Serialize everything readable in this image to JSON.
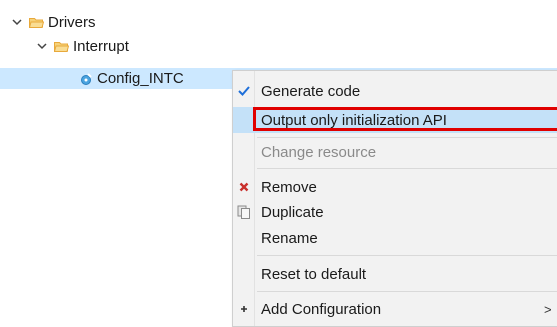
{
  "tree": {
    "drivers": {
      "label": "Drivers"
    },
    "interrupt": {
      "label": "Interrupt"
    },
    "config": {
      "label": "Config_INTC"
    }
  },
  "menu": {
    "items": [
      {
        "label": "Generate code",
        "icon": "checkmark-icon",
        "checked": true,
        "disabled": false
      },
      {
        "label": "Output only initialization API",
        "highlighted": true,
        "disabled": false
      },
      {
        "label": "Change resource",
        "disabled": true
      },
      {
        "label": "Remove",
        "icon": "remove-icon",
        "disabled": false
      },
      {
        "label": "Duplicate",
        "icon": "duplicate-icon",
        "disabled": false
      },
      {
        "label": "Rename",
        "disabled": false
      },
      {
        "label": "Reset to default",
        "disabled": false
      },
      {
        "label": "Add Configuration",
        "icon": "add-icon",
        "submenu": true,
        "disabled": false
      }
    ],
    "submenu_arrow": ">"
  },
  "colors": {
    "selection": "#cce8ff",
    "menu_bg": "#f2f2f2",
    "highlight": "#c4e1f8",
    "annotation_red": "#e00000",
    "folder": "#e8a93b",
    "check": "#1e6fd9",
    "remove": "#c9302c"
  }
}
